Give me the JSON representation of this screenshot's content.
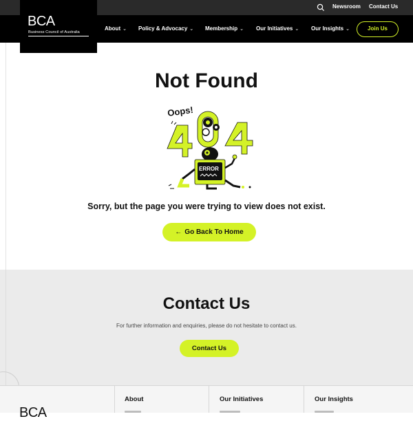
{
  "topbar": {
    "newsroom": "Newsroom",
    "contact": "Contact Us"
  },
  "logo": {
    "short": "BCA",
    "full": "Business Council of Australia"
  },
  "nav": {
    "items": [
      {
        "label": "About"
      },
      {
        "label": "Policy & Advocacy"
      },
      {
        "label": "Membership"
      },
      {
        "label": "Our Initiatives"
      },
      {
        "label": "Our Insights"
      }
    ],
    "join": "Join Us"
  },
  "main": {
    "title": "Not Found",
    "illustration": {
      "oops": "Oops!",
      "code": "404",
      "error": "ERROR"
    },
    "message": "Sorry, but the page you were trying to view does not exist.",
    "home_button": "Go Back To Home"
  },
  "contact": {
    "title": "Contact Us",
    "text": "For further information and enquiries, please do not hesitate to contact us.",
    "button": "Contact Us"
  },
  "footer": {
    "logo": "BCA",
    "columns": [
      "About",
      "Our Initiatives",
      "Our Insights"
    ]
  },
  "colors": {
    "accent": "#d4f227",
    "nav_bg": "#000000",
    "topbar_bg": "#2a2a2a",
    "contact_bg": "#ebebeb"
  }
}
